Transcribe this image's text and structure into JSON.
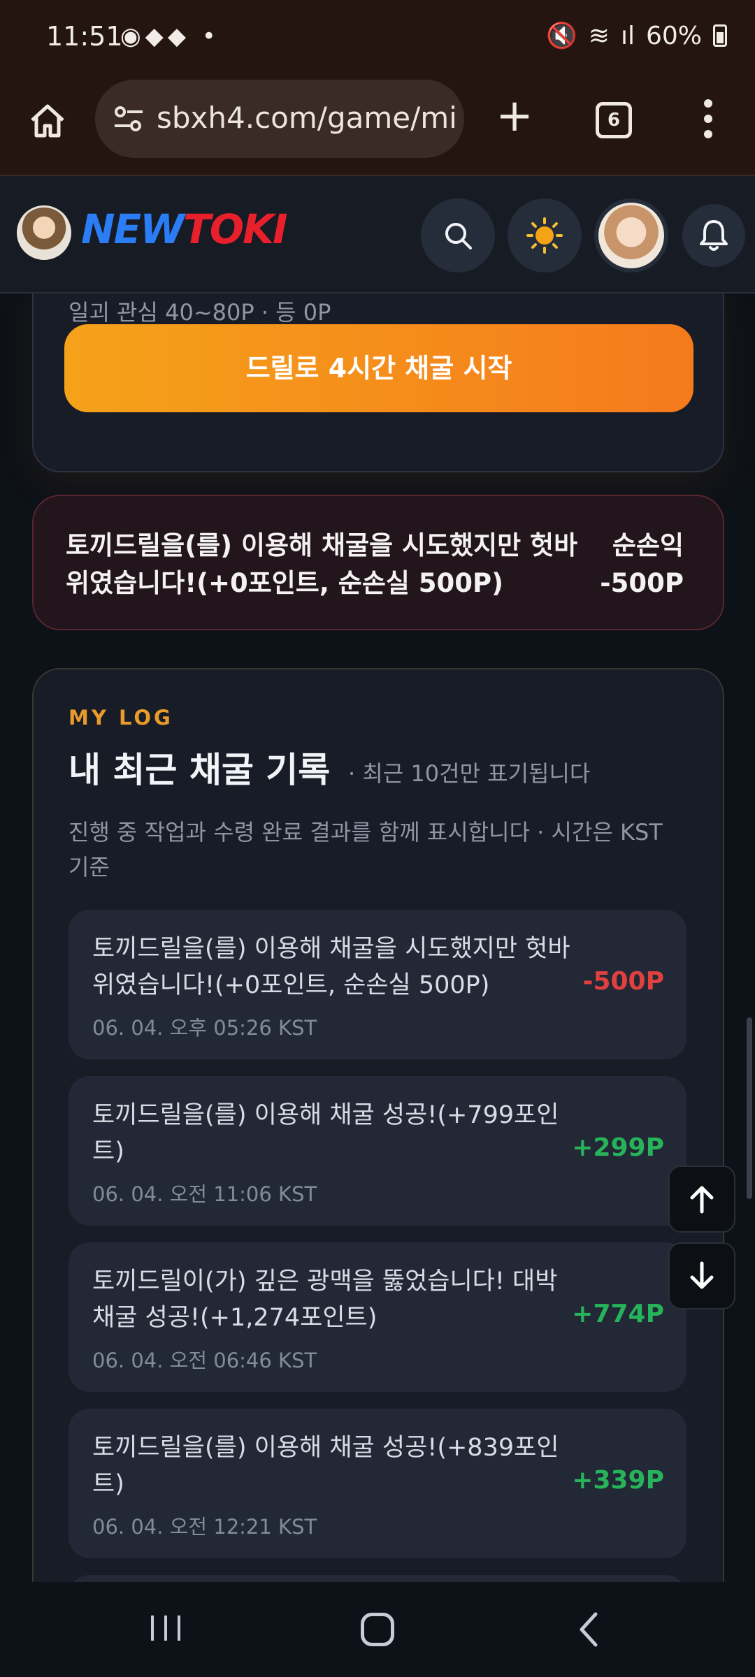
{
  "status_bar": {
    "time": "11:51",
    "battery": "60%"
  },
  "browser": {
    "url": "sbxh4.com/game/mi",
    "tab_count": "6"
  },
  "site": {
    "logo_part1": "NEW",
    "logo_part2": "TOKI"
  },
  "mining_card": {
    "cut_text": "일괴 관심 40~80P · 등 0P",
    "start_button": "드릴로 4시간 채굴 시작"
  },
  "result": {
    "message": "토끼드릴을(를) 이용해 채굴을 시도했지만 헛바위였습니다!(+0포인트, 순손실 500P)",
    "net_label": "순손익",
    "net_value": "-500P"
  },
  "my_log": {
    "kicker": "MY LOG",
    "title": "내 최근 채굴 기록",
    "subtitle": "· 최근 10건만 표기됩니다",
    "description": "진행 중 작업과 수령 완료 결과를 함께 표시합니다 · 시간은 KST 기준",
    "items": [
      {
        "message": "토끼드릴을(를) 이용해 채굴을 시도했지만 헛바위였습니다!(+0포인트, 순손실 500P)",
        "time": "06. 04. 오후 05:26 KST",
        "amount": "-500P"
      },
      {
        "message": "토끼드릴을(를) 이용해 채굴 성공!(+799포인트)",
        "time": "06. 04. 오전 11:06 KST",
        "amount": "+299P"
      },
      {
        "message": "토끼드릴이(가) 깊은 광맥을 뚫었습니다! 대박 채굴 성공!(+1,274포인트)",
        "time": "06. 04. 오전 06:46 KST",
        "amount": "+774P"
      },
      {
        "message": "토끼드릴을(를) 이용해 채굴 성공!(+839포인트)",
        "time": "06. 04. 오전 12:21 KST",
        "amount": "+339P"
      }
    ]
  },
  "colors": {
    "accent_orange": "#f58a1c",
    "negative": "#e0403e",
    "positive": "#27b35a"
  }
}
